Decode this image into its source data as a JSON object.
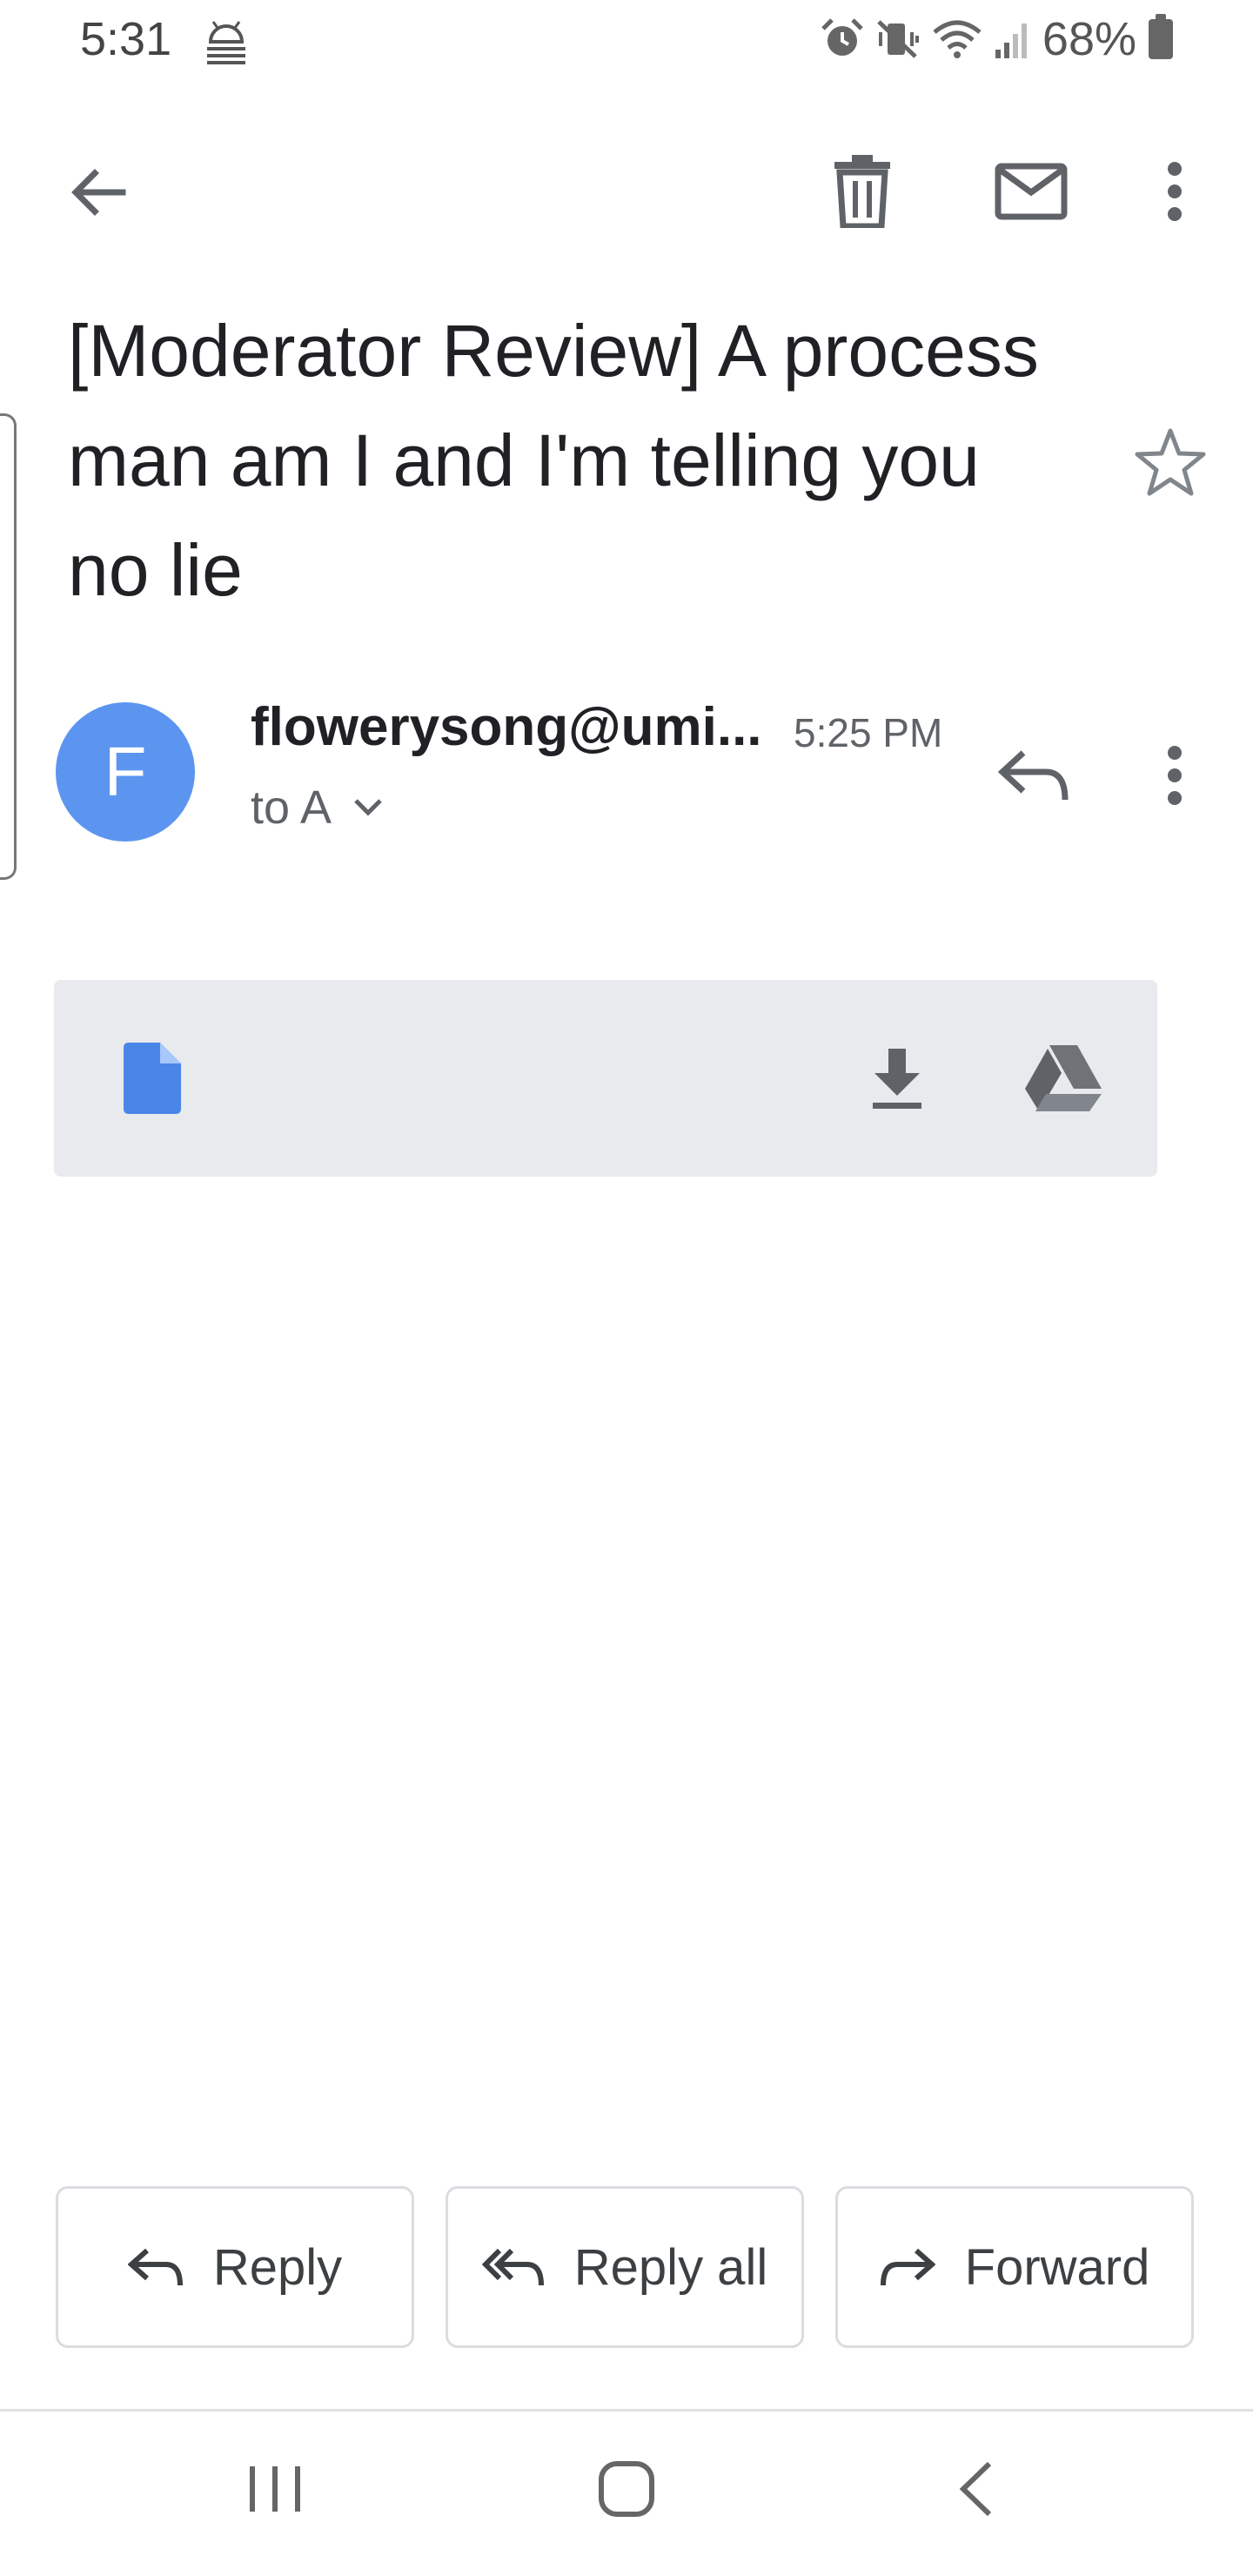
{
  "status_bar": {
    "time": "5:31",
    "battery": "68%"
  },
  "email": {
    "subject": "[Moderator Review] A process man am I and I'm telling you no lie",
    "avatar_letter": "F",
    "sender": "flowerysong@umi...",
    "time": "5:25 PM",
    "recipients": "to A"
  },
  "actions": {
    "reply": "Reply",
    "reply_all": "Reply all",
    "forward": "Forward"
  },
  "colors": {
    "avatar": "#5c95f0",
    "file_icon": "#4a86e8",
    "attachment_bg": "#e8eaed"
  }
}
